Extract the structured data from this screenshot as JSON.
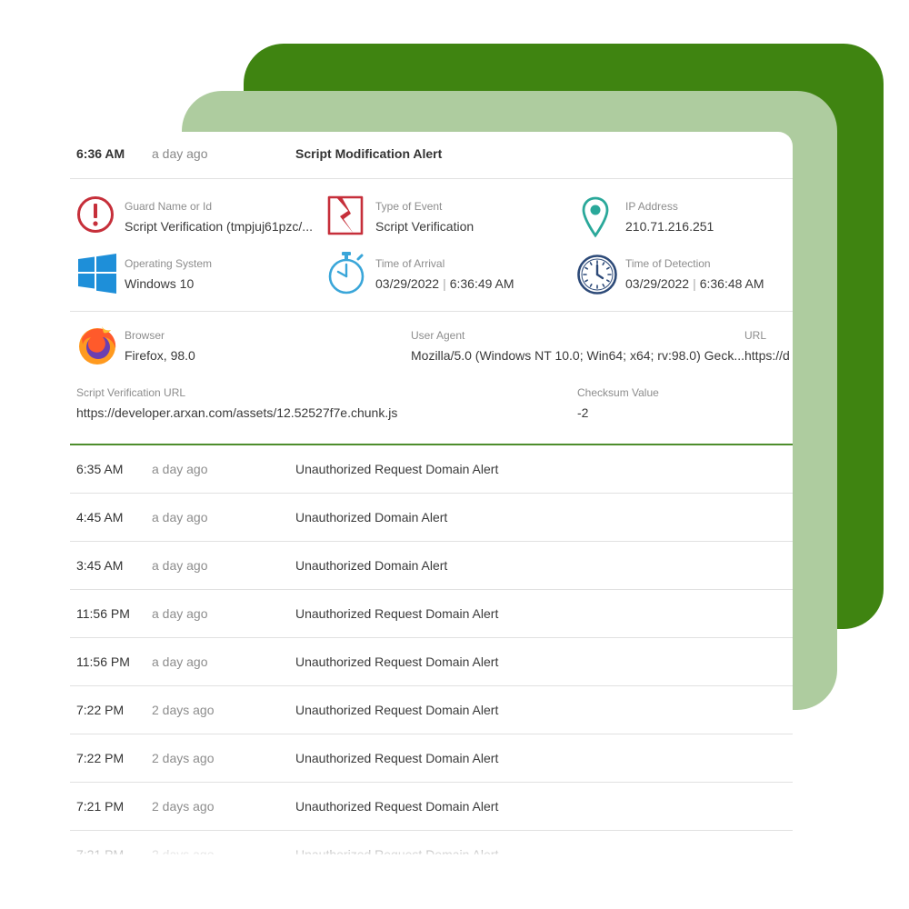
{
  "header": {
    "time": "6:36 AM",
    "ago": "a day ago",
    "title": "Script Modification Alert"
  },
  "fields": {
    "guard": {
      "label": "Guard Name or Id",
      "value": "Script Verification (tmpjuj61pzc/..."
    },
    "event_type": {
      "label": "Type of Event",
      "value": "Script Verification"
    },
    "ip": {
      "label": "IP Address",
      "value": "210.71.216.251"
    },
    "os": {
      "label": "Operating System",
      "value": "Windows 10"
    },
    "arrival": {
      "label": "Time of Arrival",
      "date": "03/29/2022",
      "time": "6:36:49 AM"
    },
    "detection": {
      "label": "Time of Detection",
      "date": "03/29/2022",
      "time": "6:36:48 AM"
    },
    "browser": {
      "label": "Browser",
      "value": "Firefox, 98.0"
    },
    "user_agent": {
      "label": "User Agent",
      "value": "Mozilla/5.0 (Windows NT 10.0; Win64; x64; rv:98.0) Geck..."
    },
    "url": {
      "label": "URL",
      "value": "https://d"
    },
    "script_url": {
      "label": "Script Verification URL",
      "value": "https://developer.arxan.com/assets/12.52527f7e.chunk.js"
    },
    "checksum": {
      "label": "Checksum Value",
      "value": "-2"
    },
    "separator": "|"
  },
  "colors": {
    "brand_green": "#3f8411",
    "light_green": "#aecc9f",
    "alert_red": "#c62f3a",
    "location_teal": "#2aa89a",
    "windows_blue": "#1e8fd9",
    "stopwatch_blue": "#3aa6d9",
    "clock_navy": "#2d4a78"
  },
  "icons": {
    "guard": "exclamation-circle-icon",
    "event_type": "broken-file-icon",
    "ip": "map-pin-icon",
    "os": "windows-logo-icon",
    "arrival": "stopwatch-icon",
    "detection": "clock-icon",
    "browser": "firefox-logo-icon"
  },
  "alerts": [
    {
      "time": "6:35 AM",
      "ago": "a day ago",
      "title": "Unauthorized Request Domain Alert"
    },
    {
      "time": "4:45 AM",
      "ago": "a day ago",
      "title": "Unauthorized Domain Alert"
    },
    {
      "time": "3:45 AM",
      "ago": "a day ago",
      "title": "Unauthorized Domain Alert"
    },
    {
      "time": "11:56 PM",
      "ago": "a day ago",
      "title": "Unauthorized Request Domain Alert"
    },
    {
      "time": "11:56 PM",
      "ago": "a day ago",
      "title": "Unauthorized Request Domain Alert"
    },
    {
      "time": "7:22 PM",
      "ago": "2 days ago",
      "title": "Unauthorized Request Domain Alert"
    },
    {
      "time": "7:22 PM",
      "ago": "2 days ago",
      "title": "Unauthorized Request Domain Alert"
    },
    {
      "time": "7:21 PM",
      "ago": "2 days ago",
      "title": "Unauthorized Request Domain Alert"
    },
    {
      "time": "7:21 PM",
      "ago": "2 days ago",
      "title": "Unauthorized Request Domain Alert"
    }
  ]
}
